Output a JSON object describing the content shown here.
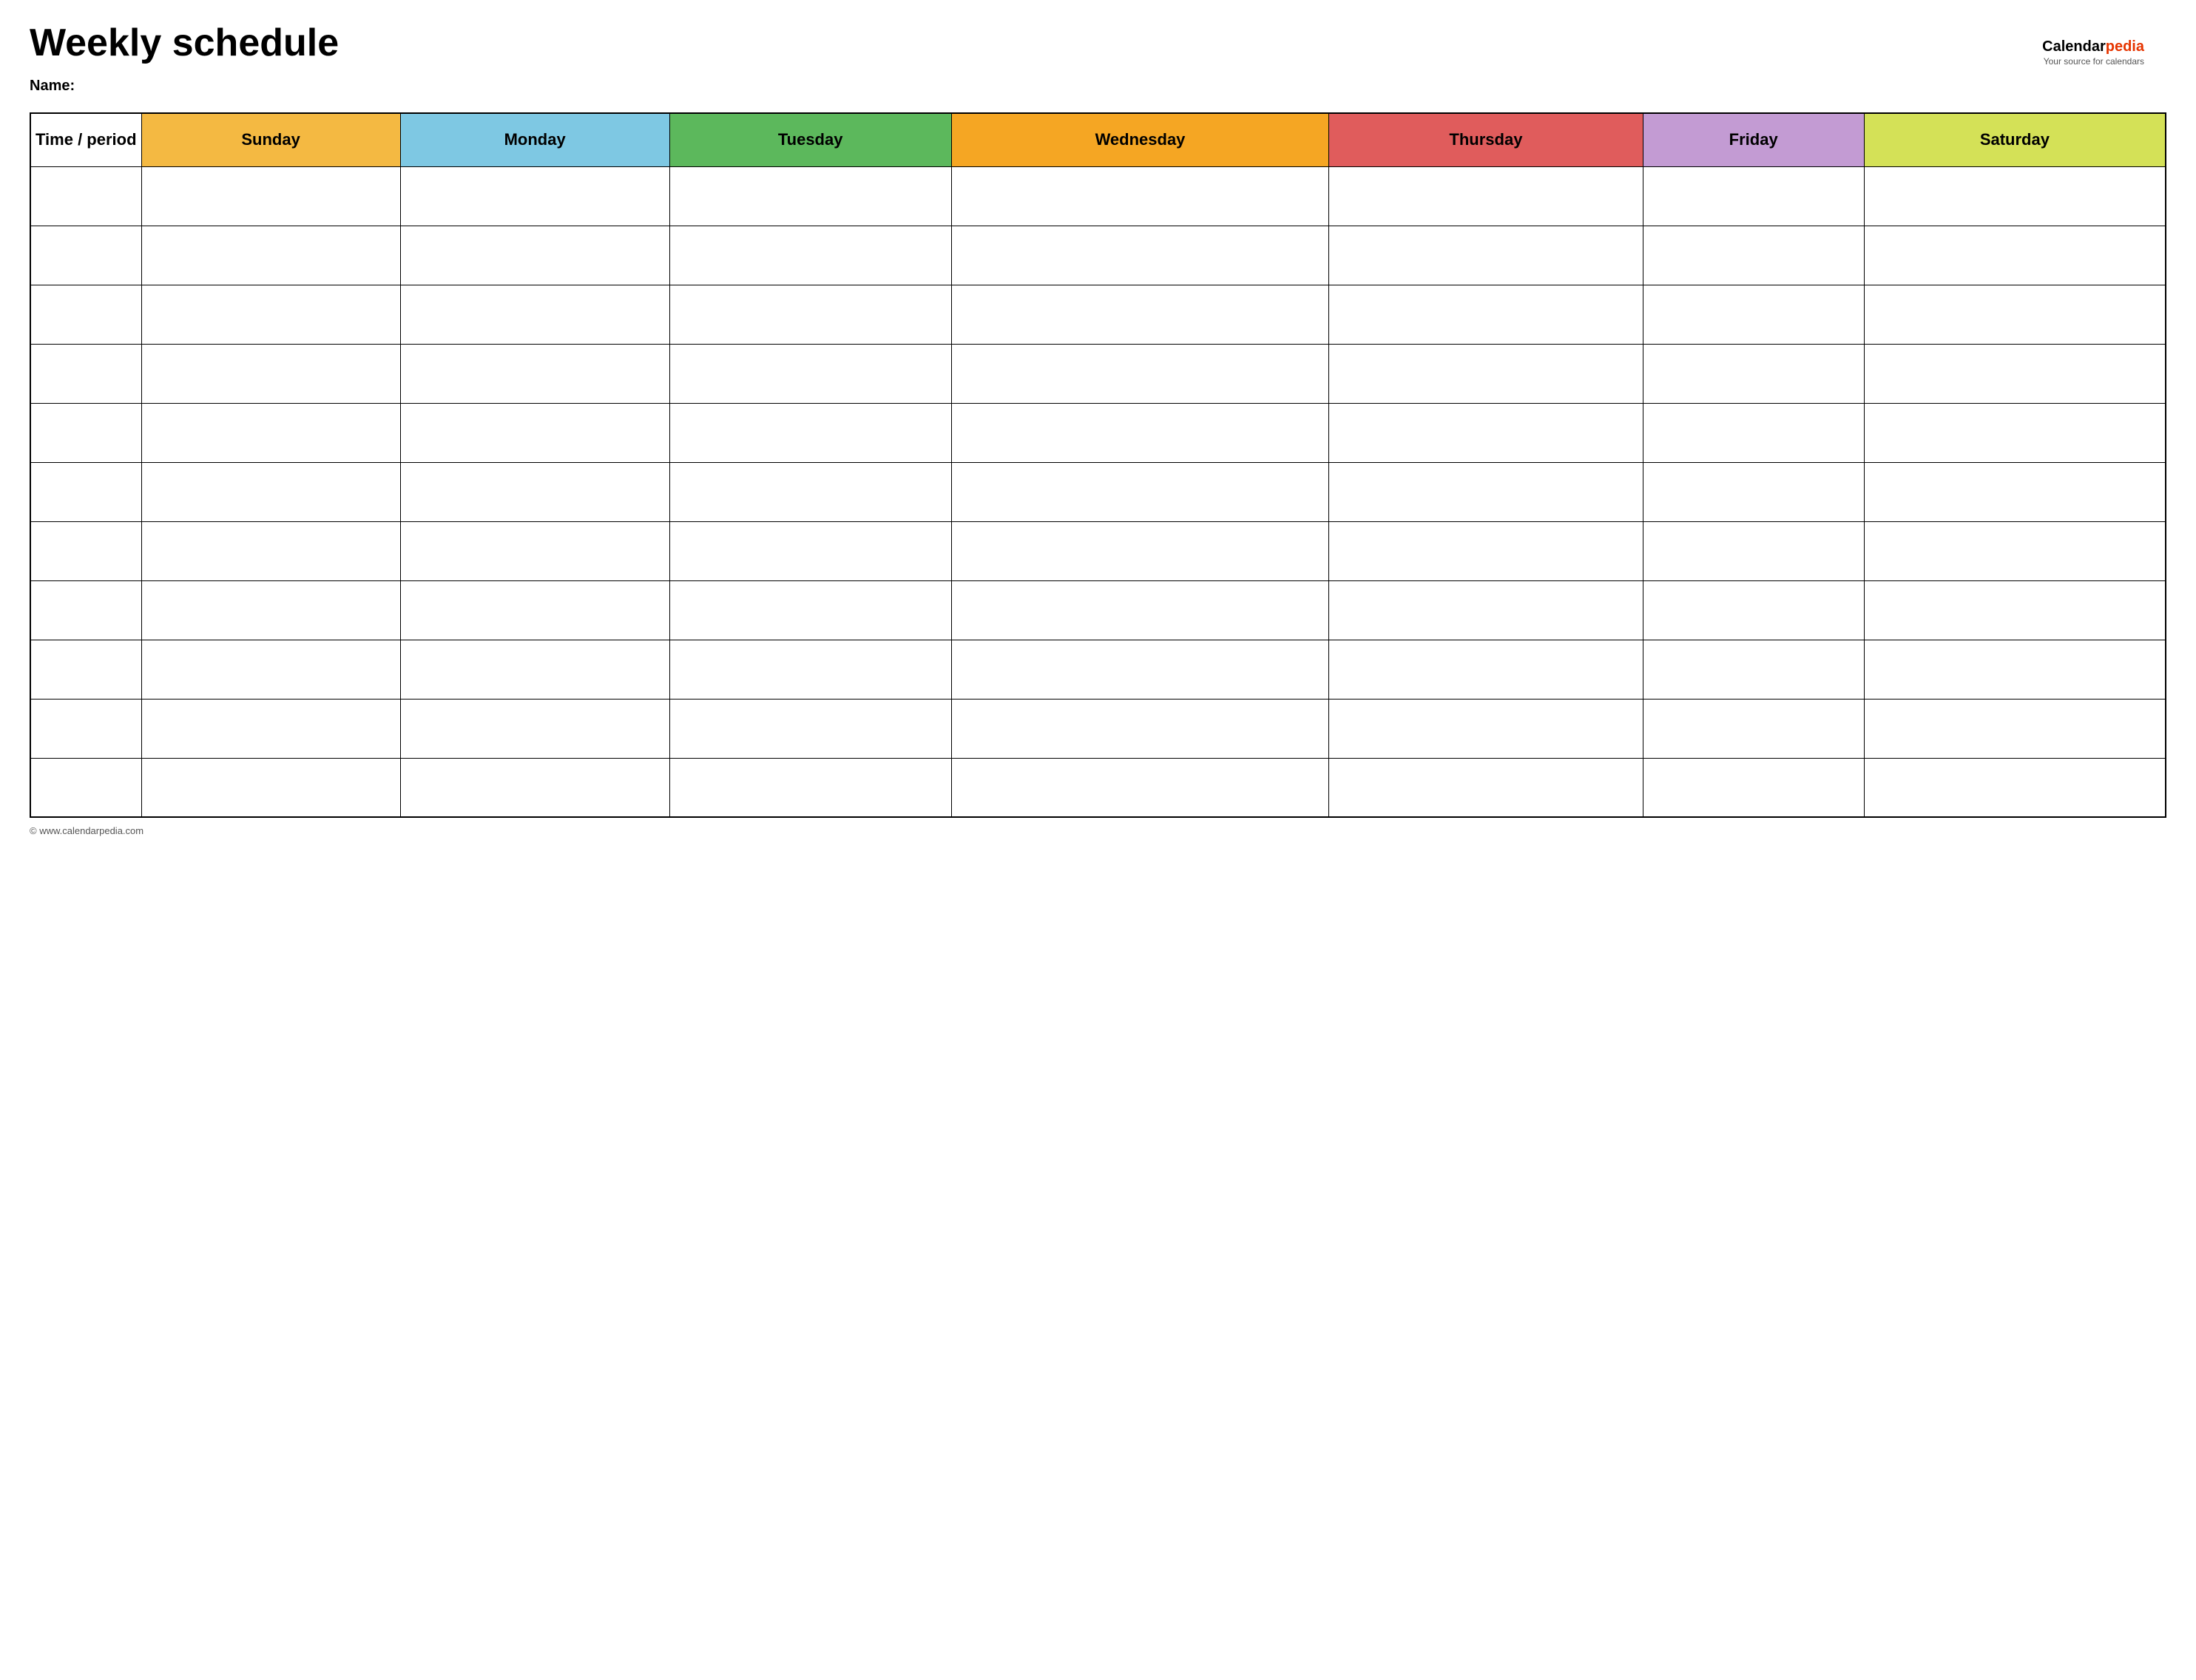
{
  "page": {
    "title": "Weekly schedule",
    "name_label": "Name:",
    "footer_url": "© www.calendarpedia.com"
  },
  "logo": {
    "brand_part1": "Calendar",
    "brand_part2": "pedia",
    "tagline": "Your source for calendars"
  },
  "table": {
    "header": {
      "time_period": "Time / period",
      "sunday": "Sunday",
      "monday": "Monday",
      "tuesday": "Tuesday",
      "wednesday": "Wednesday",
      "thursday": "Thursday",
      "friday": "Friday",
      "saturday": "Saturday"
    },
    "row_count": 11
  }
}
